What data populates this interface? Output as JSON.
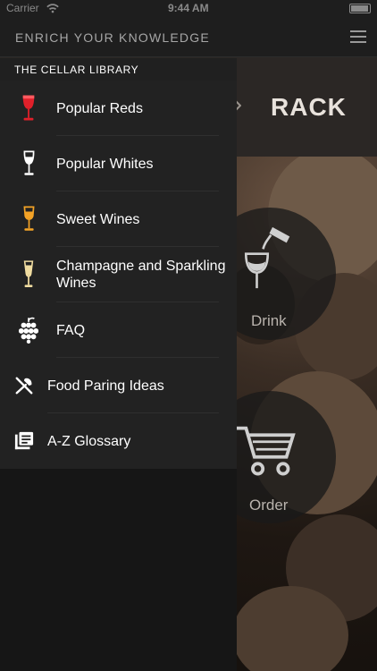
{
  "status_bar": {
    "carrier": "Carrier",
    "time": "9:44 AM"
  },
  "topbar": {
    "title": "ENRICH YOUR KNOWLEDGE",
    "menu_icon": "hamburger-menu-icon"
  },
  "drawer": {
    "section_title": "THE CELLAR LIBRARY",
    "items": [
      {
        "label": "Popular Reds",
        "icon": "red-wine-glass-icon",
        "color": "#e0202a"
      },
      {
        "label": "Popular Whites",
        "icon": "white-wine-glass-icon",
        "color": "#ffffff"
      },
      {
        "label": "Sweet Wines",
        "icon": "sweet-wine-glass-icon",
        "color": "#f4a326"
      },
      {
        "label": "Champagne and Sparkling Wines",
        "icon": "champagne-flute-icon",
        "color": "#f0dca0"
      },
      {
        "label": "FAQ",
        "icon": "grapes-icon",
        "color": "#ffffff"
      },
      {
        "label": "Food Paring Ideas",
        "icon": "fork-knife-icon",
        "color": "#ffffff"
      },
      {
        "label": "A-Z Glossary",
        "icon": "glossary-book-icon",
        "color": "#ffffff"
      }
    ]
  },
  "background": {
    "title": "RACK",
    "drink_label": "Drink",
    "order_label": "Order"
  }
}
